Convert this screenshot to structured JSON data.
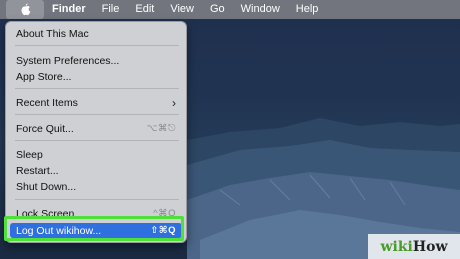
{
  "menubar": {
    "app_name": "Finder",
    "items": [
      "File",
      "Edit",
      "View",
      "Go",
      "Window",
      "Help"
    ]
  },
  "apple_menu": {
    "about": "About This Mac",
    "system_prefs": "System Preferences...",
    "app_store": "App Store...",
    "recent_items": "Recent Items",
    "force_quit": "Force Quit...",
    "force_quit_shortcut": "⌥⌘⎋",
    "sleep": "Sleep",
    "restart": "Restart...",
    "shut_down": "Shut Down...",
    "lock_screen": "Lock Screen",
    "lock_screen_shortcut": "^⌘Q",
    "log_out": "Log Out wikihow...",
    "log_out_shortcut": "⇧⌘Q"
  },
  "watermark": {
    "part1": "wiki",
    "part2": "How"
  },
  "colors": {
    "selection": "#2f6fde",
    "highlight": "#4fe03a"
  }
}
